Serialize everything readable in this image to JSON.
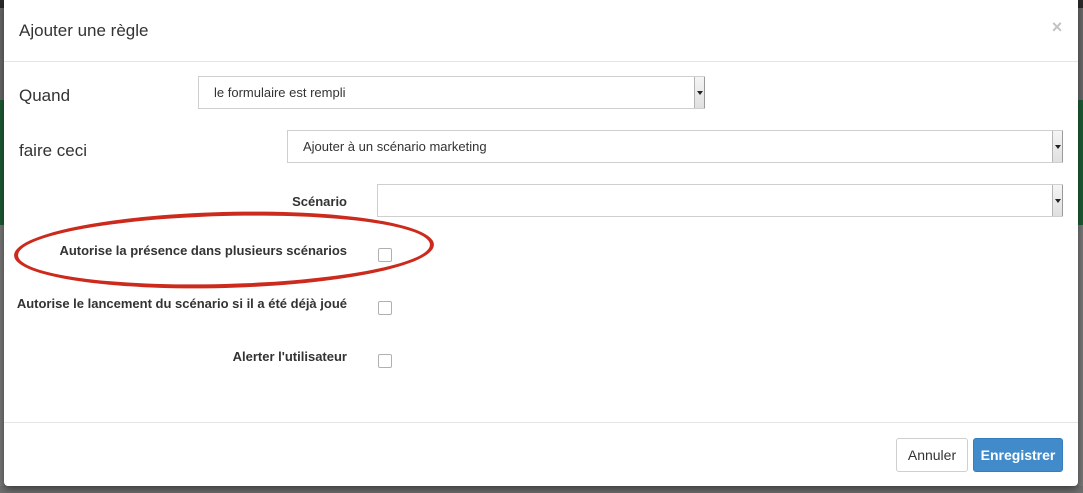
{
  "modal": {
    "title": "Ajouter une règle",
    "close": "×"
  },
  "form": {
    "when_label": "Quand",
    "when_value": "le formulaire est rempli",
    "do_label": "faire ceci",
    "do_value": "Ajouter à un scénario marketing",
    "scenario_label": "Scénario",
    "scenario_value": "",
    "allow_multiple_label": "Autorise la présence dans plusieurs scénarios",
    "allow_multiple_checked": false,
    "allow_relaunch_label": "Autorise le lancement du scénario si il a été déjà joué",
    "allow_relaunch_checked": false,
    "alert_user_label": "Alerter l'utilisateur",
    "alert_user_checked": false
  },
  "footer": {
    "cancel_label": "Annuler",
    "save_label": "Enregistrer"
  },
  "colors": {
    "primary": "#428bca",
    "highlight": "#cc2a1c",
    "background_green": "#1e5e36"
  }
}
